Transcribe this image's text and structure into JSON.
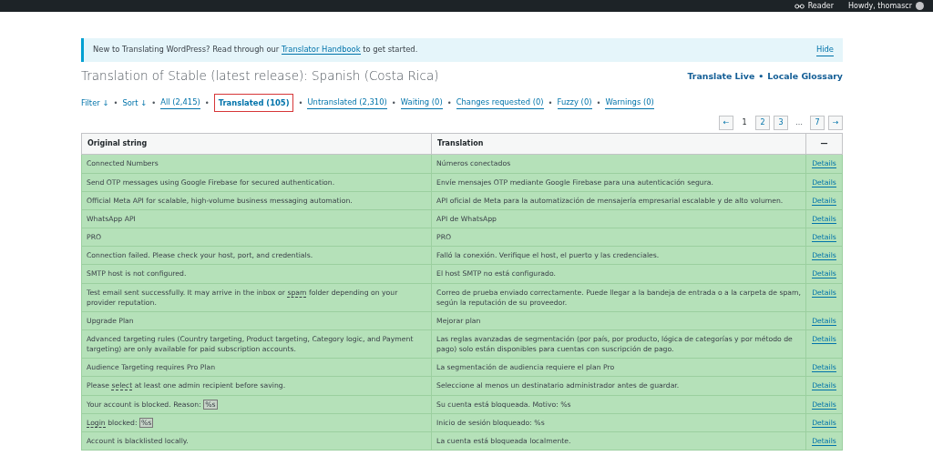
{
  "admin_bar": {
    "reader": "Reader",
    "greeting": "Howdy, thomascr"
  },
  "notice": {
    "before": "New to Translating WordPress? Read through our ",
    "link": "Translator Handbook",
    "after": " to get started.",
    "dismiss": "Hide"
  },
  "separator": "•",
  "page_title": "Translation of Stable (latest release): Spanish (Costa Rica)",
  "header_links": [
    {
      "label": "Translate Live"
    },
    {
      "label": "Locale Glossary"
    }
  ],
  "sorters": [
    {
      "label": "Filter ↓"
    },
    {
      "label": "Sort ↓"
    }
  ],
  "filters": [
    {
      "label": "All (2,415)",
      "selected": false
    },
    {
      "label": "Translated (105)",
      "selected": true
    },
    {
      "label": "Untranslated (2,310)",
      "selected": false
    },
    {
      "label": "Waiting (0)",
      "selected": false
    },
    {
      "label": "Changes requested (0)",
      "selected": false
    },
    {
      "label": "Fuzzy (0)",
      "selected": false
    },
    {
      "label": "Warnings (0)",
      "selected": false
    }
  ],
  "pagination": [
    {
      "label": "←",
      "kind": "arrow"
    },
    {
      "label": "1",
      "kind": "page",
      "selected": true
    },
    {
      "label": "2",
      "kind": "page",
      "selected": false
    },
    {
      "label": "3",
      "kind": "page",
      "selected": false
    },
    {
      "label": "…",
      "kind": "gap"
    },
    {
      "label": "7",
      "kind": "page",
      "selected": false
    },
    {
      "label": "→",
      "kind": "arrow"
    }
  ],
  "table": {
    "columns": [
      "Original string",
      "Translation",
      "—"
    ],
    "rows": [
      {
        "original": [
          {
            "kind": "text",
            "text": "Connected Numbers"
          }
        ],
        "translation": "Números conectados",
        "action": "Details"
      },
      {
        "original": [
          {
            "kind": "text",
            "text": "Send OTP messages using Google Firebase for secured authentication."
          }
        ],
        "translation": "Envíe mensajes OTP mediante Google Firebase para una autenticación segura.",
        "action": "Details"
      },
      {
        "original": [
          {
            "kind": "text",
            "text": "Official Meta API for scalable, high-volume business messaging automation."
          }
        ],
        "translation": "API oficial de Meta para la automatización de mensajería empresarial escalable y de alto volumen.",
        "action": "Details"
      },
      {
        "original": [
          {
            "kind": "text",
            "text": "WhatsApp API"
          }
        ],
        "translation": "API de WhatsApp",
        "action": "Details"
      },
      {
        "original": [
          {
            "kind": "text",
            "text": "PRO"
          }
        ],
        "translation": "PRO",
        "action": "Details"
      },
      {
        "original": [
          {
            "kind": "text",
            "text": "Connection failed. Please check your host, port, and credentials."
          }
        ],
        "translation": "Falló la conexión. Verifique el host, el puerto y las credenciales.",
        "action": "Details"
      },
      {
        "original": [
          {
            "kind": "text",
            "text": "SMTP host is not configured."
          }
        ],
        "translation": "El host SMTP no está configurado.",
        "action": "Details"
      },
      {
        "original": [
          {
            "kind": "text",
            "text": "Test email sent successfully. It may arrive in the inbox or "
          },
          {
            "kind": "glossary",
            "text": "spam"
          },
          {
            "kind": "text",
            "text": " folder depending on your provider reputation."
          }
        ],
        "translation": "Correo de prueba enviado correctamente. Puede llegar a la bandeja de entrada o a la carpeta de spam, según la reputación de su proveedor.",
        "action": "Details"
      },
      {
        "original": [
          {
            "kind": "text",
            "text": "Upgrade Plan"
          }
        ],
        "translation": "Mejorar plan",
        "action": "Details"
      },
      {
        "original": [
          {
            "kind": "text",
            "text": "Advanced targeting rules (Country targeting, Product targeting, Category logic, and Payment targeting) are only available for paid subscription accounts."
          }
        ],
        "translation": "Las reglas avanzadas de segmentación (por país, por producto, lógica de categorías y por método de pago) solo están disponibles para cuentas con suscripción de pago.",
        "action": "Details"
      },
      {
        "original": [
          {
            "kind": "text",
            "text": "Audience Targeting requires Pro Plan"
          }
        ],
        "translation": "La segmentación de audiencia requiere el plan Pro",
        "action": "Details"
      },
      {
        "original": [
          {
            "kind": "text",
            "text": "Please "
          },
          {
            "kind": "glossary",
            "text": "select"
          },
          {
            "kind": "text",
            "text": " at least one admin recipient before saving."
          }
        ],
        "translation": "Seleccione al menos un destinatario administrador antes de guardar.",
        "action": "Details"
      },
      {
        "original": [
          {
            "kind": "text",
            "text": "Your account is blocked. Reason: "
          },
          {
            "kind": "placeholder",
            "text": "%s"
          }
        ],
        "translation": "Su cuenta está bloqueada. Motivo: %s",
        "action": "Details"
      },
      {
        "original": [
          {
            "kind": "glossary",
            "text": "Login"
          },
          {
            "kind": "text",
            "text": " blocked: "
          },
          {
            "kind": "placeholder",
            "text": "%s"
          }
        ],
        "translation": "Inicio de sesión bloqueado: %s",
        "action": "Details"
      },
      {
        "original": [
          {
            "kind": "text",
            "text": "Account is blacklisted locally."
          }
        ],
        "translation": "La cuenta está bloqueada localmente.",
        "action": "Details"
      }
    ]
  }
}
